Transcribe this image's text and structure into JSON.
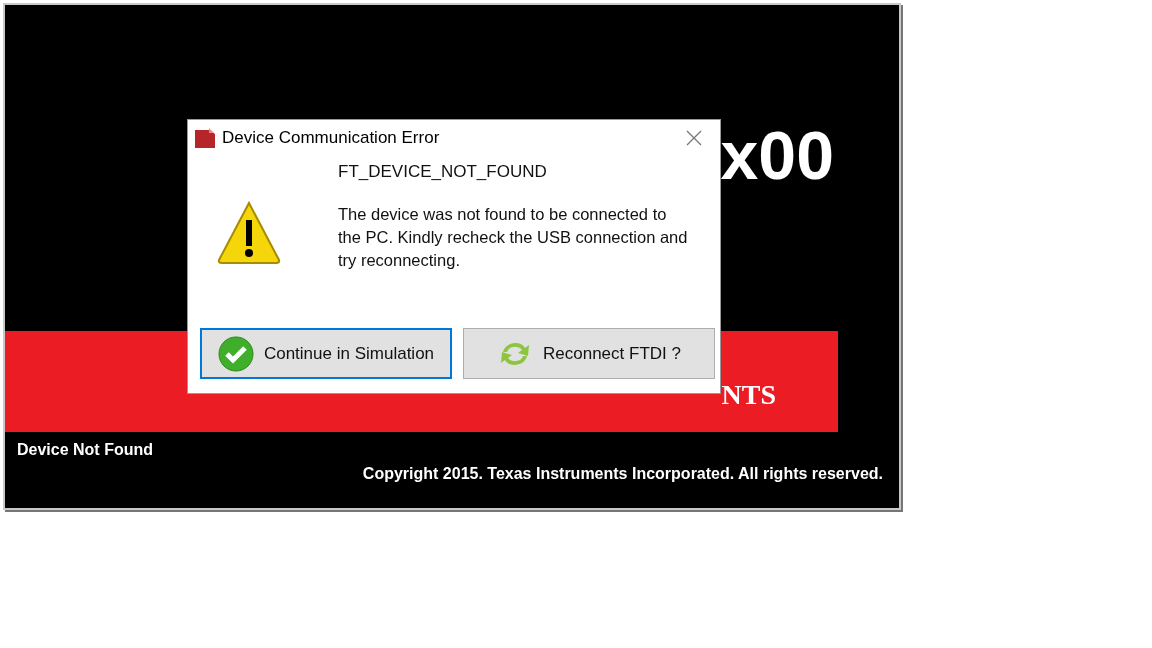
{
  "splash": {
    "title_fragment": "x00",
    "logo_fragment": "NTS",
    "status": "Device Not Found",
    "copyright": "Copyright 2015. Texas Instruments Incorporated. All rights reserved."
  },
  "dialog": {
    "title": "Device Communication Error",
    "heading": "FT_DEVICE_NOT_FOUND",
    "message": "The device was not found to be connected to the PC. Kindly recheck the USB connection and try reconnecting.",
    "buttons": [
      {
        "label": "Continue in Simulation",
        "kind": "check",
        "selected": true
      },
      {
        "label": "Reconnect FTDI ?",
        "kind": "refresh",
        "selected": false
      }
    ]
  }
}
